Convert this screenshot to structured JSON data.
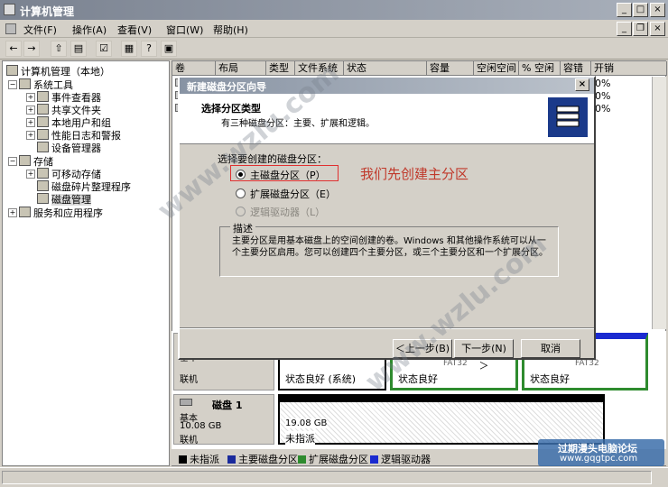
{
  "window": {
    "title": "计算机管理",
    "minimize": "_",
    "maximize": "□",
    "close": "×"
  },
  "menu": [
    "文件(F)",
    "操作(A)",
    "查看(V)",
    "窗口(W)",
    "帮助(H)"
  ],
  "inner_controls": {
    "minimize": "_",
    "restore": "❐",
    "close": "×"
  },
  "tree": {
    "root": "计算机管理（本地）",
    "system_tools": "系统工具",
    "event_viewer": "事件查看器",
    "shared_folders": "共享文件夹",
    "local_users": "本地用户和组",
    "perf_logs": "性能日志和警报",
    "device_manager": "设备管理器",
    "storage": "存储",
    "removable": "可移动存储",
    "defrag": "磁盘碎片整理程序",
    "disk_mgmt": "磁盘管理",
    "services": "服务和应用程序"
  },
  "columns": [
    "卷",
    "布局",
    "类型",
    "文件系统",
    "状态",
    "容量",
    "空闲空间",
    "% 空闲",
    "容错",
    "开销"
  ],
  "pct_rows": [
    "0%",
    "0%",
    "0%"
  ],
  "disk0": {
    "label_a": "基本",
    "label_b": "联机",
    "p1_status": "状态良好 (系统)",
    "p2_fs": "FAT32",
    "p2_status": "状态良好",
    "p3_fs": "FAT32",
    "p3_status": "状态良好"
  },
  "disk1": {
    "name": "磁盘 1",
    "type": "基本",
    "size": "10.08 GB",
    "state": "联机",
    "part_size": "19.08 GB",
    "part_status": "未指派"
  },
  "legend": [
    {
      "label": "未指派",
      "color": "#000000"
    },
    {
      "label": "主要磁盘分区",
      "color": "#1a2a9c"
    },
    {
      "label": "扩展磁盘分区",
      "color": "#2e8b2e"
    },
    {
      "label": "逻辑驱动器",
      "color": "#1a2ad0"
    }
  ],
  "dialog": {
    "title": "新建磁盘分区向导",
    "header_title": "选择分区类型",
    "header_sub": "有三种磁盘分区：主要、扩展和逻辑。",
    "group_label": "选择要创建的磁盘分区：",
    "option_primary": "主磁盘分区（P）",
    "option_extended": "扩展磁盘分区（E）",
    "option_logical": "逻辑驱动器（L）",
    "desc_label": "描述",
    "desc_text": "主要分区是用基本磁盘上的空间创建的卷。Windows 和其他操作系统可以从一个主要分区启用。您可以创建四个主要分区，或三个主要分区和一个扩展分区。",
    "annotation": "我们先创建主分区",
    "back": "＜上一步(B)",
    "next": "下一步(N) ＞",
    "cancel": "取消",
    "close": "×"
  },
  "watermark": {
    "text": "www.wzlu.com",
    "site": "过期漫头电脑论坛",
    "url": "www.gqgtpc.com"
  },
  "colors": {
    "annotation": "#c0392b",
    "highlight_box": "#e03030",
    "primary_bar": "#1a2a9c",
    "ext_border": "#2e8b2e"
  }
}
